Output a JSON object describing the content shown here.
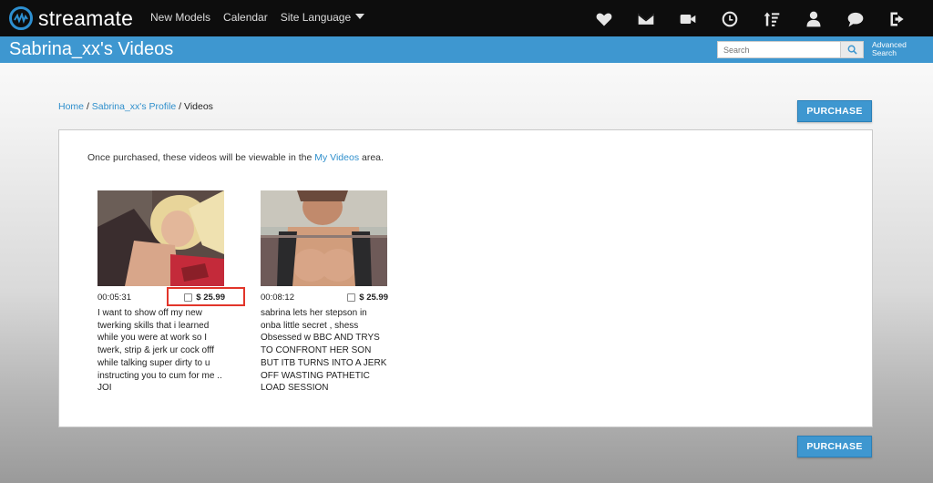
{
  "brand": {
    "name": "streamate",
    "logo_icon": "streamate-logo-icon"
  },
  "nav": {
    "links": [
      "New Models",
      "Calendar",
      "Site Language"
    ],
    "icons": [
      "heart-icon",
      "mail-icon",
      "video-camera-icon",
      "clock-icon",
      "sort-icon",
      "user-icon",
      "chat-icon",
      "logout-icon"
    ]
  },
  "header": {
    "title": "Sabrina_xx's Videos",
    "search": {
      "placeholder": "Search",
      "value": ""
    },
    "advanced_line1": "Advanced",
    "advanced_line2": "Search"
  },
  "breadcrumb": {
    "home": "Home",
    "profile": "Sabrina_xx's Profile",
    "sep": "/",
    "current": "Videos"
  },
  "purchase_label": "PURCHASE",
  "intro": {
    "before": "Once purchased, these videos will be viewable in the ",
    "link": "My Videos",
    "after": " area."
  },
  "videos": [
    {
      "duration": "00:05:31",
      "price": "$ 25.99",
      "checked": false,
      "description": "I want to show off my new twerking skills that i learned while you were at work so I twerk, strip & jerk ur cock offf while talking super dirty to u instructing you to cum for me .. JOI"
    },
    {
      "duration": "00:08:12",
      "price": "$ 25.99",
      "checked": false,
      "description": "sabrina lets her stepson in onba little secret , shess Obsessed w BBC AND TRYS TO CONFRONT HER SON BUT ITB TURNS INTO A JERK OFF WASTING PATHETIC LOAD SESSION"
    }
  ],
  "colors": {
    "accent": "#3e97d0",
    "highlight": "#e2352a",
    "topbar": "#0d0d0d"
  }
}
